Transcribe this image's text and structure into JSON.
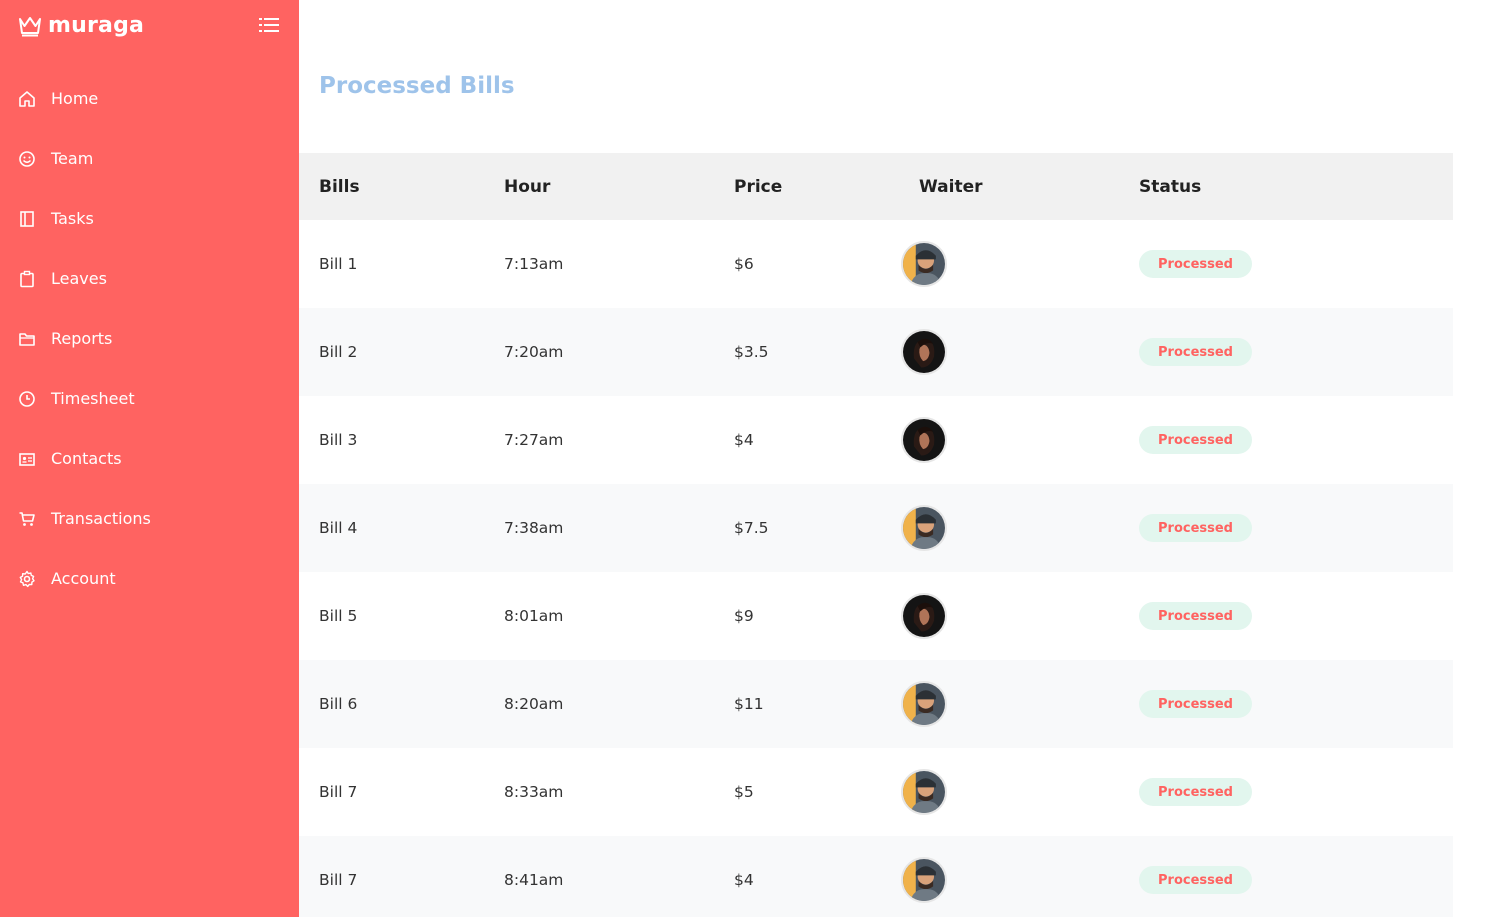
{
  "brand": {
    "name": "muraga"
  },
  "colors": {
    "sidebar": "#ff6361",
    "title": "#9ec3ea",
    "badge_bg": "#e2f6ee",
    "badge_text": "#ff6361"
  },
  "sidebar": {
    "items": [
      {
        "label": "Home",
        "icon": "home-icon"
      },
      {
        "label": "Team",
        "icon": "smile-icon"
      },
      {
        "label": "Tasks",
        "icon": "notebook-icon"
      },
      {
        "label": "Leaves",
        "icon": "clipboard-icon"
      },
      {
        "label": "Reports",
        "icon": "folder-icon"
      },
      {
        "label": "Timesheet",
        "icon": "clock-icon"
      },
      {
        "label": "Contacts",
        "icon": "contact-card-icon"
      },
      {
        "label": "Transactions",
        "icon": "cart-icon"
      },
      {
        "label": "Account",
        "icon": "gear-icon"
      }
    ]
  },
  "main": {
    "title": "Processed Bills",
    "table": {
      "headers": {
        "bills": "Bills",
        "hour": "Hour",
        "price": "Price",
        "waiter": "Waiter",
        "status": "Status"
      },
      "rows": [
        {
          "bill": "Bill 1",
          "hour": "7:13am",
          "price": "$6",
          "waiter": "waiter-avatar-a",
          "status": "Processed"
        },
        {
          "bill": "Bill 2",
          "hour": "7:20am",
          "price": "$3.5",
          "waiter": "waiter-avatar-b",
          "status": "Processed"
        },
        {
          "bill": "Bill 3",
          "hour": "7:27am",
          "price": "$4",
          "waiter": "waiter-avatar-b",
          "status": "Processed"
        },
        {
          "bill": "Bill 4",
          "hour": "7:38am",
          "price": "$7.5",
          "waiter": "waiter-avatar-a",
          "status": "Processed"
        },
        {
          "bill": "Bill 5",
          "hour": "8:01am",
          "price": "$9",
          "waiter": "waiter-avatar-b",
          "status": "Processed"
        },
        {
          "bill": "Bill 6",
          "hour": "8:20am",
          "price": "$11",
          "waiter": "waiter-avatar-a",
          "status": "Processed"
        },
        {
          "bill": "Bill 7",
          "hour": "8:33am",
          "price": "$5",
          "waiter": "waiter-avatar-a",
          "status": "Processed"
        },
        {
          "bill": "Bill 7",
          "hour": "8:41am",
          "price": "$4",
          "waiter": "waiter-avatar-a",
          "status": "Processed"
        }
      ]
    }
  }
}
